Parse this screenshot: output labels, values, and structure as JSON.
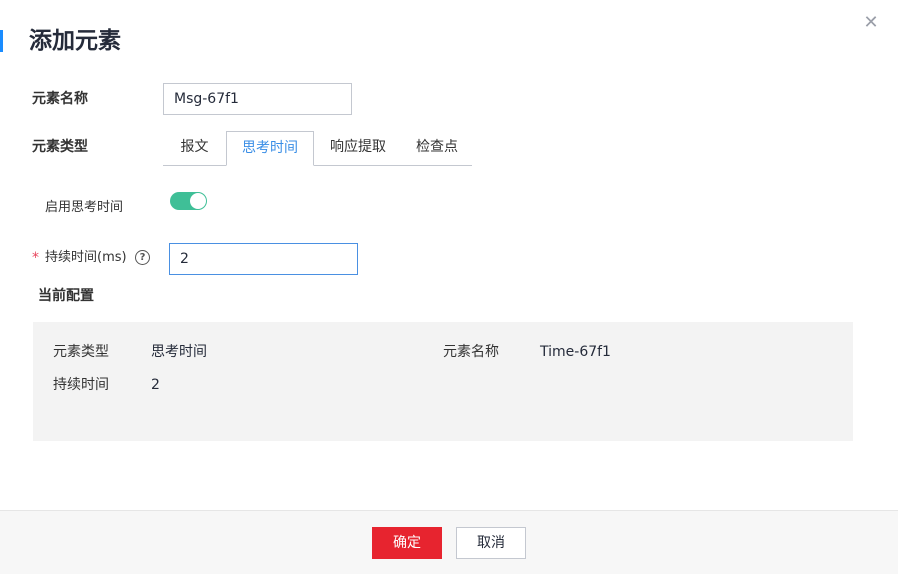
{
  "dialog": {
    "title": "添加元素",
    "close_icon": "close-icon"
  },
  "form": {
    "element_name_label": "元素名称",
    "element_name_value": "Msg-67f1",
    "element_type_label": "元素类型",
    "tabs": [
      {
        "label": "报文",
        "active": false
      },
      {
        "label": "思考时间",
        "active": true
      },
      {
        "label": "响应提取",
        "active": false
      },
      {
        "label": "检查点",
        "active": false
      }
    ],
    "enable_think_label": "启用思考时间",
    "enable_think_on": true,
    "required_mark": "*",
    "duration_label": "持续时间(ms)",
    "duration_value": "2",
    "help_icon": "question-circle-icon"
  },
  "current_config": {
    "heading": "当前配置",
    "type_key": "元素类型",
    "type_value": "思考时间",
    "name_key": "元素名称",
    "name_value": "Time-67f1",
    "duration_key": "持续时间",
    "duration_value": "2"
  },
  "footer": {
    "confirm_label": "确定",
    "cancel_label": "取消"
  },
  "colors": {
    "accent": "#1a8cff",
    "primary_button": "#e7242f",
    "switch_on": "#3fbf97",
    "active_tab_text": "#3a8ee6"
  }
}
